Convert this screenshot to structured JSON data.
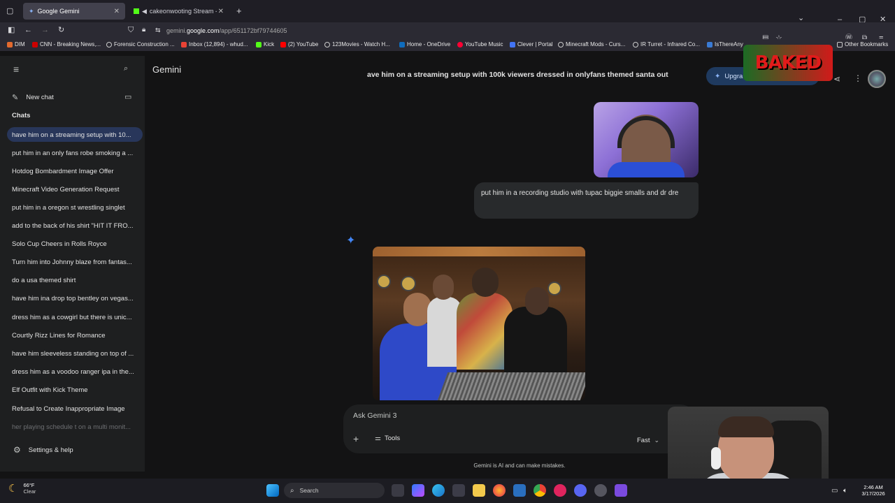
{
  "browser": {
    "tabs": [
      {
        "title": "Google Gemini",
        "active": true
      },
      {
        "title": "cakeonwooting Stream - W",
        "active": false
      }
    ],
    "url_prefix": "gemini.",
    "url_domain": "google.com",
    "url_path": "/app/651172bf79744605",
    "bookmarks": [
      "DIM",
      "CNN - Breaking News,...",
      "Forensic Construction ...",
      "Inbox (12,894) - whud...",
      "Kick",
      "(2) YouTube",
      "123Movies - Watch H...",
      "Home - OneDrive",
      "YouTube Music",
      "Clever | Portal",
      "Minecraft Mods - Curs...",
      "IR Turret - Infrared Co...",
      "IsThereAny"
    ],
    "other_bookmarks": "Other Bookmarks"
  },
  "sidebar": {
    "new_chat": "New chat",
    "chats_heading": "Chats",
    "chats": [
      "have him on a streaming setup with 10...",
      "put him in an only fans robe smoking a ...",
      "Hotdog Bombardment Image Offer",
      "Minecraft Video Generation Request",
      "put him in a oregon st wrestling singlet",
      "add to the back of his shirt \"HIT IT FRO...",
      "Solo Cup Cheers in Rolls Royce",
      "Turn him into Johnny blaze from fantas...",
      "do a usa themed shirt",
      "have him ina drop top bentley on vegas...",
      "dress him as a cowgirl but there is unic...",
      "Courtly Rizz Lines for Romance",
      "have him sleeveless standing on top of ...",
      "dress him as a voodoo ranger ipa in the...",
      "Elf Outfit with Kick Theme",
      "Refusal to Create Inappropriate Image",
      "her playing schedule t on a multi monit..."
    ],
    "settings": "Settings & help"
  },
  "main": {
    "app_name": "Gemini",
    "conversation_title": "ave him on a streaming setup with 100k viewers dressed in onlyfans themed santa out",
    "upgrade_label": "Upgra",
    "overlay_logo": "BAKED",
    "user_message": "put him in a recording studio with tupac biggie smalls and dr dre",
    "input_placeholder": "Ask Gemini 3",
    "tools_label": "Tools",
    "mode_label": "Fast",
    "disclaimer": "Gemini is AI and can make mistakes."
  },
  "taskbar": {
    "weather_temp": "66°F",
    "weather_cond": "Clear",
    "search_label": "Search",
    "time": "2:46 AM",
    "date": "3/17/2026"
  },
  "colors": {
    "sidebar_bg": "#1e1f20",
    "main_bg": "#131314",
    "active_chat": "#28365a",
    "accent_blue": "#4285f4"
  }
}
